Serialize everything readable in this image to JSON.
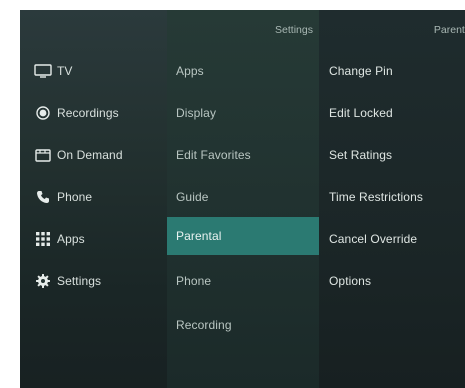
{
  "main_menu": {
    "items": [
      {
        "label": "TV",
        "icon": "tv-icon"
      },
      {
        "label": "Recordings",
        "icon": "record-icon"
      },
      {
        "label": "On Demand",
        "icon": "clapperboard-icon"
      },
      {
        "label": "Phone",
        "icon": "phone-icon"
      },
      {
        "label": "Apps",
        "icon": "apps-grid-icon"
      },
      {
        "label": "Settings",
        "icon": "gear-icon"
      }
    ]
  },
  "settings_menu": {
    "header": "Settings",
    "selected": "Parental",
    "items": [
      "Apps",
      "Display",
      "Edit Favorites",
      "Guide",
      "Parental",
      "Phone",
      "Recording"
    ]
  },
  "parental_menu": {
    "header": "Parental",
    "items": [
      "Change Pin",
      "Edit Locked",
      "Set Ratings",
      "Time Restrictions",
      "Cancel Override",
      "Options"
    ]
  },
  "colors": {
    "selected_highlight": "#2b7a72",
    "background": "#22302f"
  }
}
